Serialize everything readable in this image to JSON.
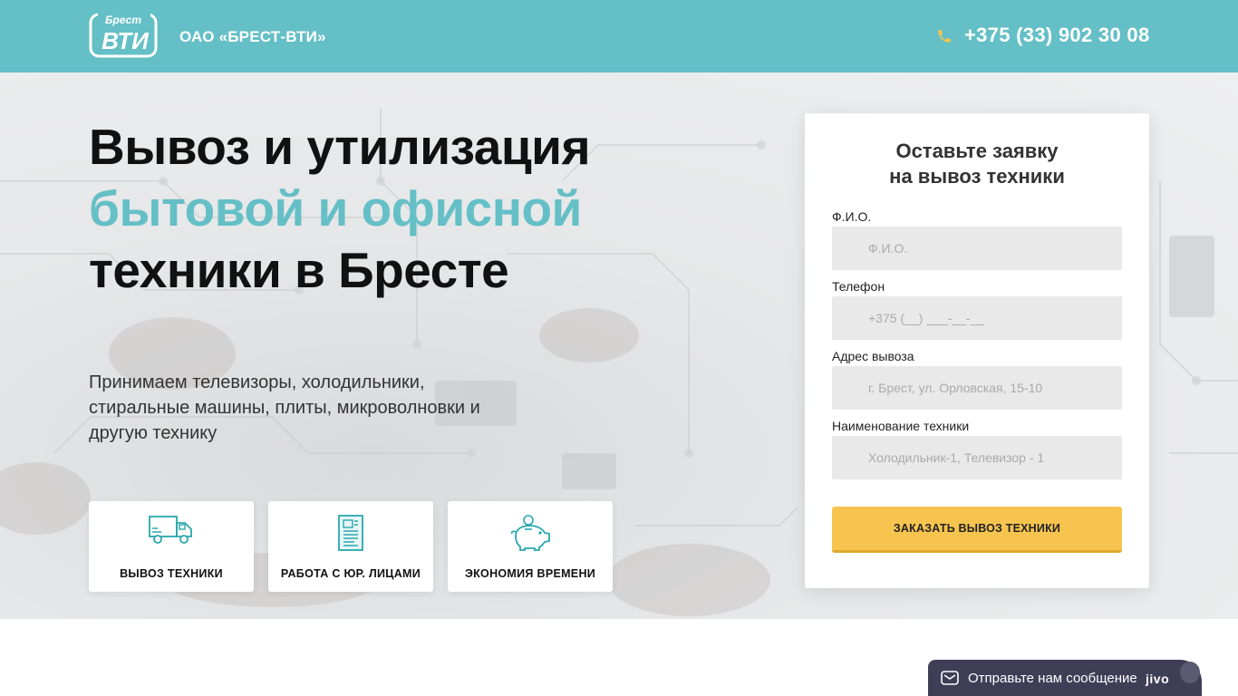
{
  "header": {
    "logo_text_top": "Брест",
    "logo_text_main": "ВТИ",
    "company": "ОАО «БРЕСТ-ВТИ»",
    "phone": "+375 (33) 902 30 08"
  },
  "hero": {
    "title_line1": "Вывоз и утилизация",
    "title_line2": "бытовой и офисной",
    "title_line3": "техники в Бресте",
    "lead": "Принимаем телевизоры, холодильники, стиральные машины, плиты, микроволновки и другую технику",
    "features": [
      {
        "label": "ВЫВОЗ ТЕХНИКИ",
        "icon": "truck-icon"
      },
      {
        "label": "РАБОТА С ЮР. ЛИЦАМИ",
        "icon": "document-icon"
      },
      {
        "label": "ЭКОНОМИЯ ВРЕМЕНИ",
        "icon": "piggy-bank-icon"
      }
    ]
  },
  "form": {
    "title_line1": "Оставьте заявку",
    "title_line2": "на вывоз техники",
    "fields": [
      {
        "label": "Ф.И.О.",
        "placeholder": "Ф.И.О.",
        "value": ""
      },
      {
        "label": "Телефон",
        "placeholder": "+375 (__) ___-__-__",
        "value": ""
      },
      {
        "label": "Адрес вывоза",
        "placeholder": "г. Брест, ул. Орловская, 15-10",
        "value": ""
      },
      {
        "label": "Наименование техники",
        "placeholder": "Холодильник-1, Телевизор - 1",
        "value": ""
      }
    ],
    "submit": "ЗАКАЗАТЬ ВЫВОЗ ТЕХНИКИ"
  },
  "chat": {
    "text": "Отправьте нам сообщение",
    "brand": "jivo"
  },
  "colors": {
    "brand": "#65bfc6",
    "button": "#f7c44f",
    "chat": "#3e3e57"
  }
}
